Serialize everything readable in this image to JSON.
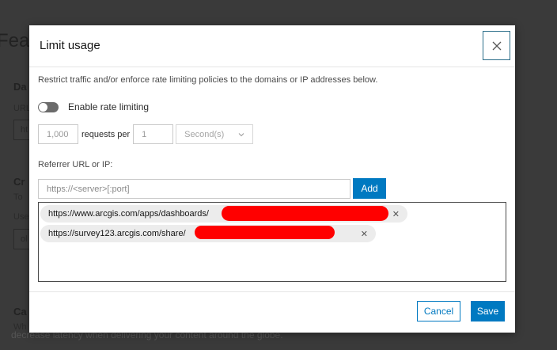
{
  "background": {
    "page_heading": "Fea",
    "labels": [
      "Da",
      "Cr",
      "Ca"
    ],
    "texts": [
      "URL",
      "To",
      "Use",
      "Wh"
    ],
    "inputs": [
      "ht",
      "ol"
    ],
    "footer_text": "decrease latency when delivering your content around the globe."
  },
  "modal": {
    "title": "Limit usage",
    "close_icon": "close-icon",
    "description": "Restrict traffic and/or enforce rate limiting policies to the domains or IP addresses below.",
    "toggle": {
      "label": "Enable rate limiting",
      "on": false
    },
    "rate": {
      "limit_placeholder": "1,000",
      "per_label": "requests per",
      "interval_placeholder": "1",
      "unit_selected": "Second(s)"
    },
    "referrer_label": "Referrer URL or IP:",
    "referrer_placeholder": "https://<server>[:port]",
    "add_label": "Add",
    "referrers": [
      {
        "url": "https://www.arcgis.com/apps/dashboards/"
      },
      {
        "url": "https://survey123.arcgis.com/share/"
      }
    ],
    "cancel_label": "Cancel",
    "save_label": "Save"
  },
  "colors": {
    "accent": "#0079c1",
    "redaction": "#ff0000"
  }
}
